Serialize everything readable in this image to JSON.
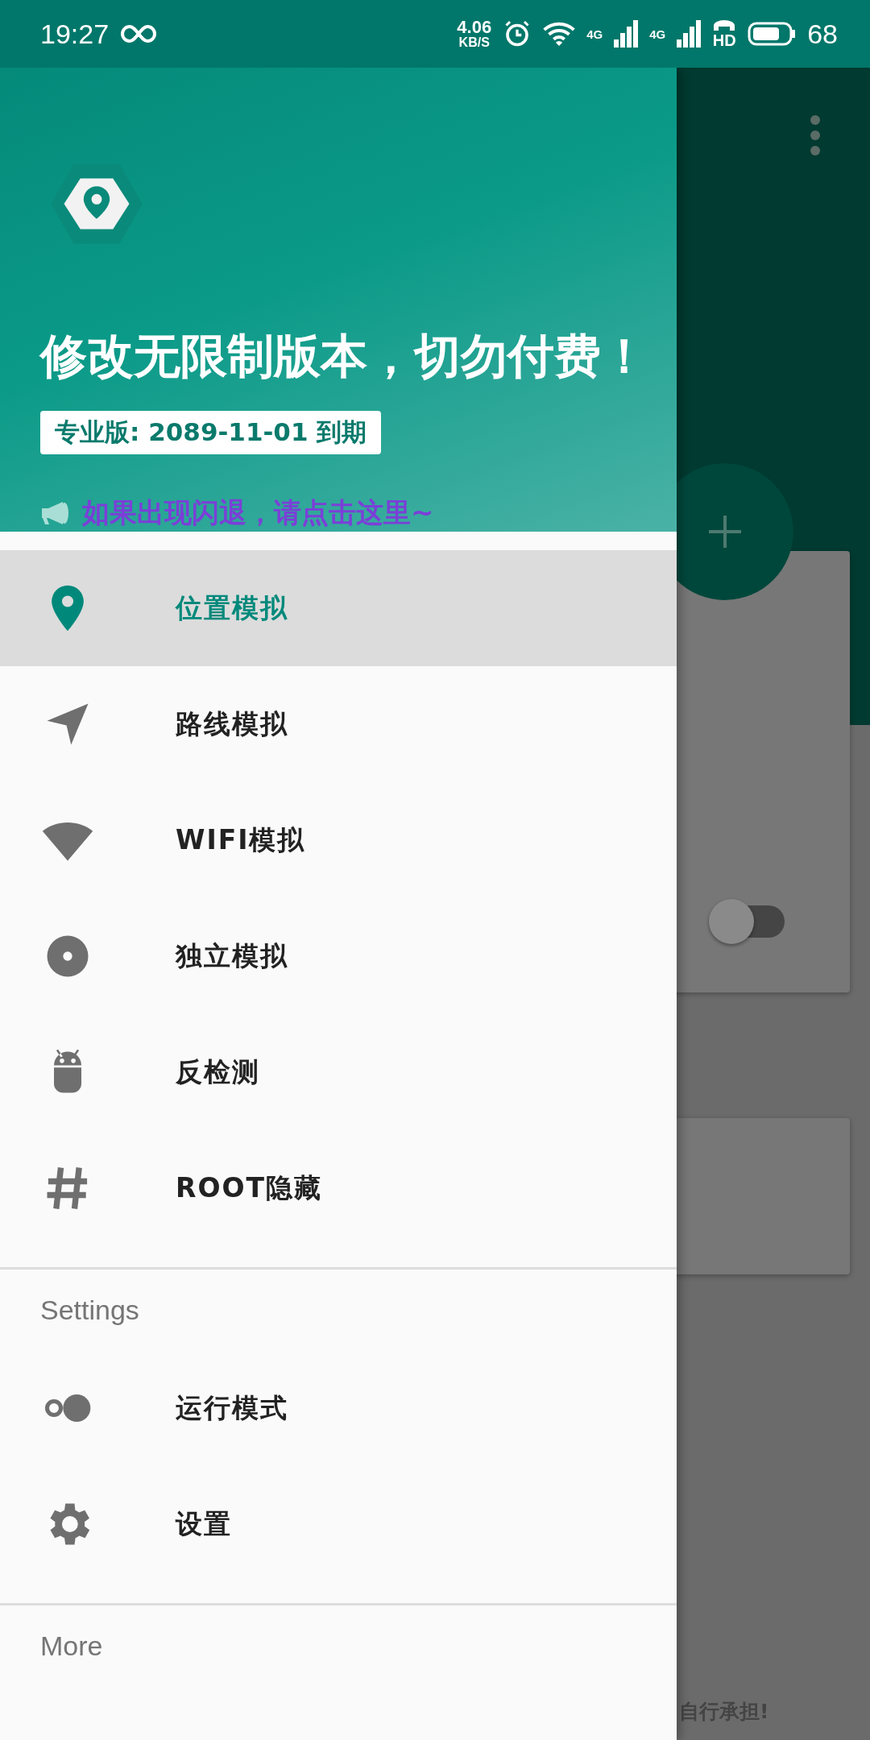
{
  "status_bar": {
    "time": "19:27",
    "net_speed": "4.06",
    "net_unit": "KB/S",
    "signal_1": "4G",
    "signal_2": "4G",
    "call_label": "HD",
    "battery": "68"
  },
  "drawer": {
    "header": {
      "title": "修改无限制版本，切勿付费！",
      "badge": "专业版: 2089-11-01 到期",
      "notice": "如果出现闪退，请点击这里~"
    },
    "sections": [
      {
        "items": [
          {
            "kind": "pin",
            "label": "位置模拟",
            "selected": true
          },
          {
            "kind": "navigation",
            "label": "路线模拟",
            "selected": false
          },
          {
            "kind": "wifi",
            "label": "WIFI模拟",
            "selected": false
          },
          {
            "kind": "disc",
            "label": "独立模拟",
            "selected": false
          },
          {
            "kind": "android",
            "label": "反检测",
            "selected": false
          },
          {
            "kind": "hash",
            "label": "ROOT隐藏",
            "selected": false
          }
        ]
      },
      {
        "heading": "Settings",
        "items": [
          {
            "kind": "toggle",
            "label": "运行模式",
            "selected": false
          },
          {
            "kind": "gear",
            "label": "设置",
            "selected": false
          }
        ]
      },
      {
        "heading": "More"
      }
    ]
  },
  "background": {
    "switch_on": false,
    "footer_text": "自行承担!"
  }
}
